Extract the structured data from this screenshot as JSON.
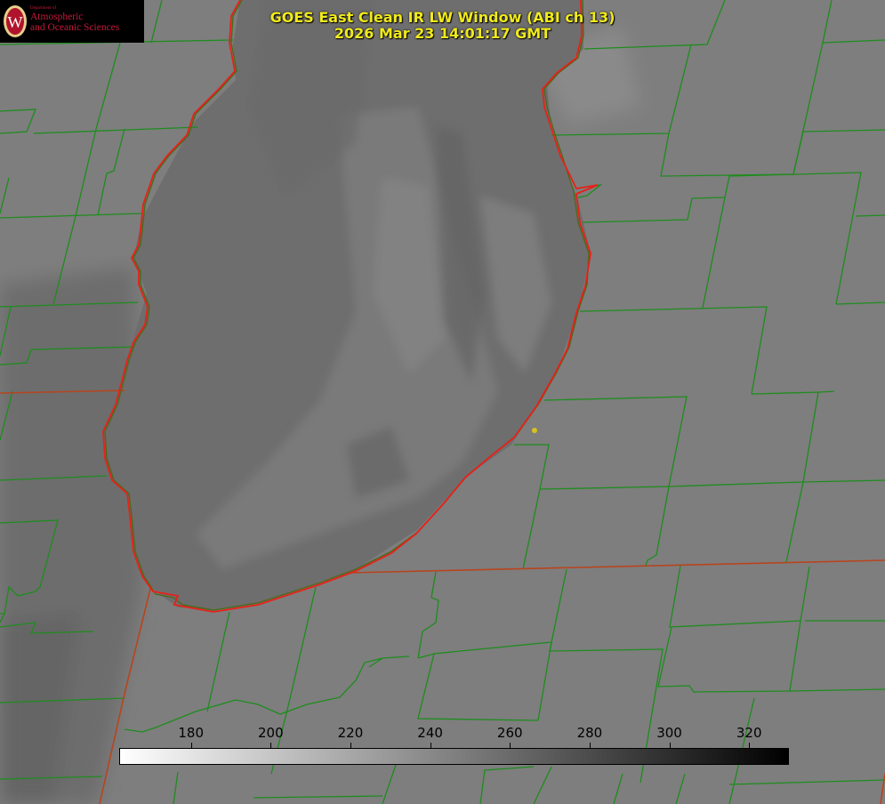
{
  "title": {
    "line1": "GOES East Clean IR LW Window (ABI ch 13)",
    "line2": "2026 Mar 23 14:01:17 GMT"
  },
  "logo": {
    "department": "Department of",
    "line1": "Atmospheric",
    "line2": "and Oceanic Sciences",
    "seal_letter": "W"
  },
  "colorbar": {
    "ticks": [
      "180",
      "200",
      "220",
      "240",
      "260",
      "280",
      "300",
      "320"
    ],
    "tick_values": [
      180,
      200,
      220,
      240,
      260,
      280,
      300,
      320
    ],
    "range": [
      162,
      330
    ],
    "low_color": "#ffffff",
    "high_color": "#000000"
  },
  "colors": {
    "county_lines": "#1e8c1e",
    "lake_outline": "#e8201a",
    "state_lines": "#b8441e",
    "title_text": "#f0ea1a",
    "marker": "#d7c21e",
    "land": "#7d7d7d",
    "lake": "#6f6f6f"
  },
  "features": [
    "lake-michigan-outline",
    "county-boundaries",
    "state-boundaries",
    "station-marker"
  ]
}
